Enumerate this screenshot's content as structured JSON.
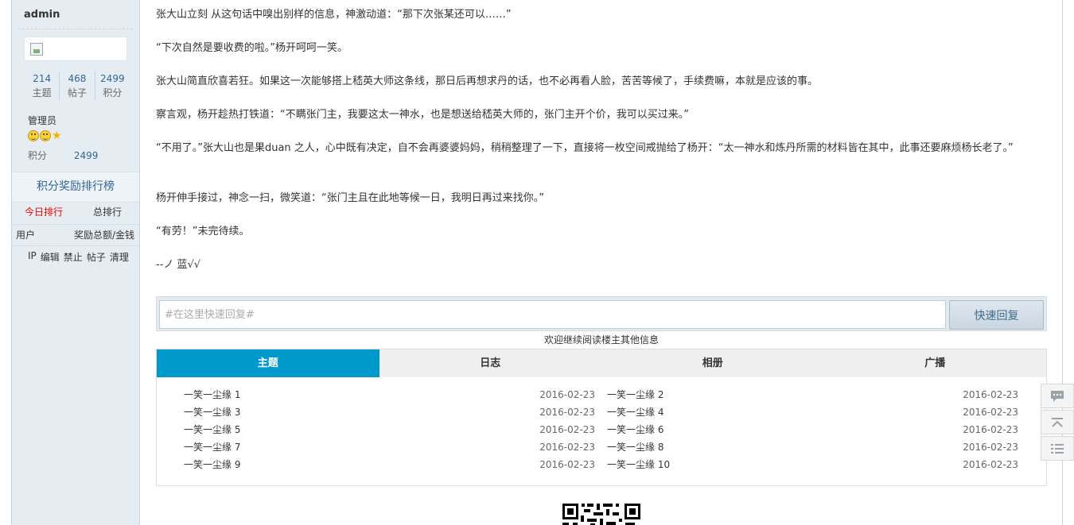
{
  "sidebar": {
    "author": "admin",
    "stats": [
      {
        "value": "214",
        "label": "主题"
      },
      {
        "value": "468",
        "label": "帖子"
      },
      {
        "value": "2499",
        "label": "积分"
      }
    ],
    "group": "管理员",
    "points_label": "积分",
    "points_value": "2499",
    "rank_title": "积分奖励排行榜",
    "rank_tabs": [
      "今日排行",
      "总排行"
    ],
    "rank_columns": {
      "user": "用户",
      "amount": "奖励总额/金钱"
    },
    "mod_tools": [
      "IP",
      "编辑",
      "禁止",
      "帖子",
      "清理"
    ]
  },
  "post": {
    "paragraphs": [
      "张大山立刻 从这句话中嗅出别样的信息，神激动道：“那下次张某还可以……”",
      "“下次自然是要收费的啦。”杨开呵呵一笑。",
      "张大山简直欣喜若狂。如果这一次能够搭上嵇英大师这条线，那日后再想求丹的话，也不必再看人脸，苦苦等候了，手续费嘛，本就是应该的事。",
      "察言观，杨开趁热打铁道：“不瞒张门主，我要这太一神水，也是想送给嵇英大师的，张门主开个价，我可以买过来。”",
      "“不用了。”张大山也是果duan 之人，心中既有决定，自不会再婆婆妈妈，稍稍整理了一下，直接将一枚空间戒抛给了杨开：“太一神水和炼丹所需的材料皆在其中，此事还要麻烦杨长老了。”",
      "杨开伸手接过，神念一扫，微笑道：“张门主且在此地等候一日，我明日再过来找你。”",
      "“有劳！”未完待续。",
      "--ノ 蓝√√"
    ]
  },
  "reply": {
    "placeholder": "#在这里快速回复#",
    "button": "快速回复"
  },
  "more_info": "欢迎继续阅读楼主其他信息",
  "tabs": [
    "主题",
    "日志",
    "相册",
    "广播"
  ],
  "threads": [
    {
      "title": "一笑一尘缘 1",
      "date": "2016-02-23"
    },
    {
      "title": "一笑一尘缘 2",
      "date": "2016-02-23"
    },
    {
      "title": "一笑一尘缘 3",
      "date": "2016-02-23"
    },
    {
      "title": "一笑一尘缘 4",
      "date": "2016-02-23"
    },
    {
      "title": "一笑一尘缘 5",
      "date": "2016-02-23"
    },
    {
      "title": "一笑一尘缘 6",
      "date": "2016-02-23"
    },
    {
      "title": "一笑一尘缘 7",
      "date": "2016-02-23"
    },
    {
      "title": "一笑一尘缘 8",
      "date": "2016-02-23"
    },
    {
      "title": "一笑一尘缘 9",
      "date": "2016-02-23"
    },
    {
      "title": "一笑一尘缘 10",
      "date": "2016-02-23"
    }
  ],
  "float_buttons": [
    "comment-icon",
    "back-to-top-icon",
    "list-icon"
  ]
}
